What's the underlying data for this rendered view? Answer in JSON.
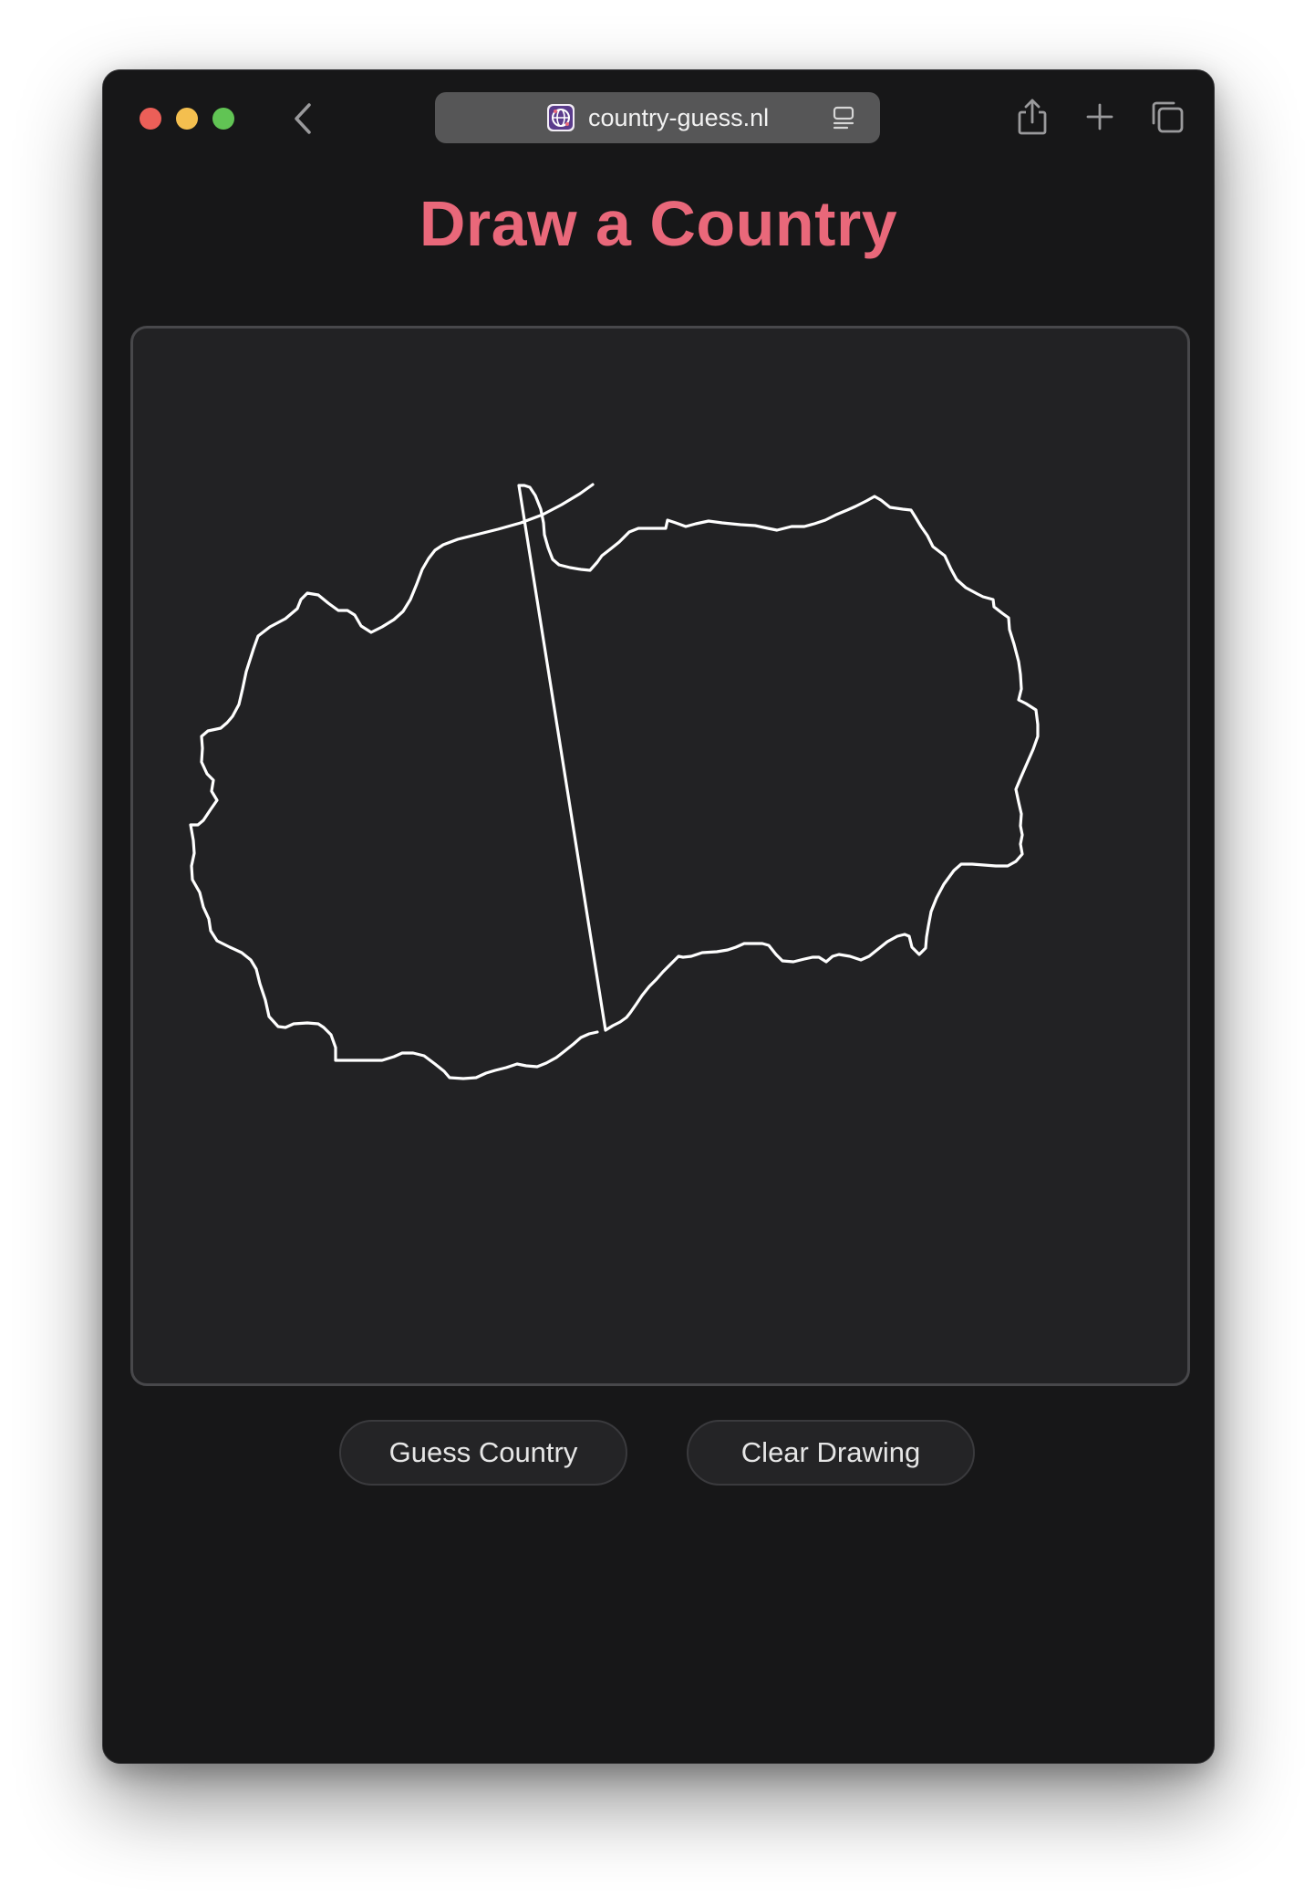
{
  "browser": {
    "url": "country-guess.nl",
    "favicon": "globe-favicon-icon",
    "icons": {
      "back": "chevron-left-icon",
      "reader": "reader-mode-icon",
      "share": "share-icon",
      "new_tab": "plus-icon",
      "tabs": "tab-overview-icon"
    },
    "traffic_lights": [
      "#ec5f58",
      "#f4bf4f",
      "#61c454"
    ]
  },
  "page": {
    "title": "Draw a Country",
    "title_color": "#e9687a",
    "canvas": {
      "stroke_color": "#ffffff",
      "drawing": "hand-drawn country outline"
    },
    "buttons": {
      "guess": "Guess Country",
      "clear": "Clear Drawing"
    }
  }
}
